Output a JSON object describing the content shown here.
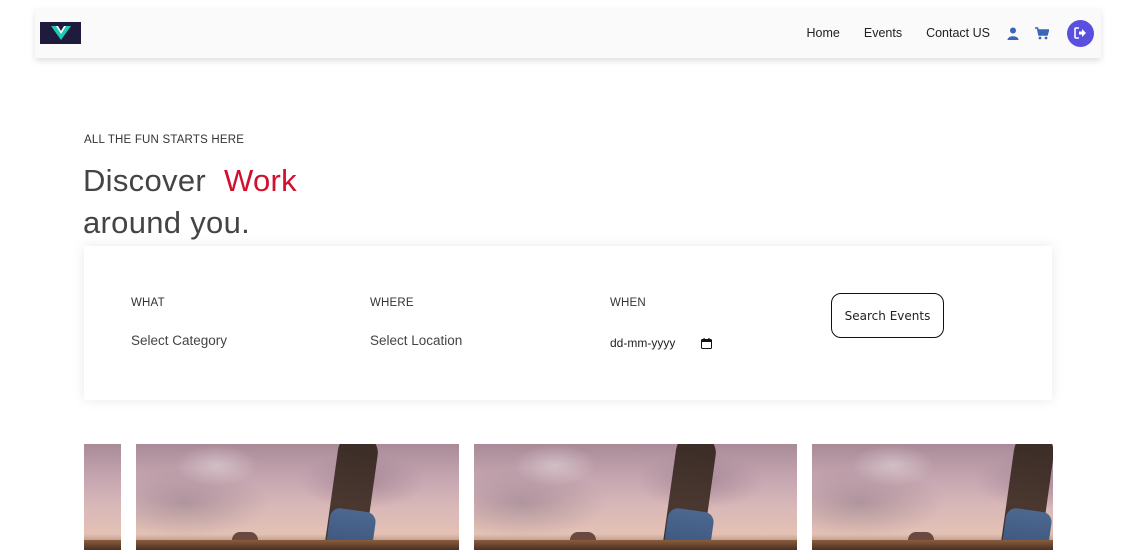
{
  "nav": {
    "links": [
      "Home",
      "Events",
      "Contact US"
    ],
    "icons": [
      "user-icon",
      "cart-icon",
      "logout-icon"
    ],
    "accent_color": "#5b4fe0"
  },
  "hero": {
    "eyebrow": "ALL THE FUN STARTS HERE",
    "headline_part1": "Discover",
    "headline_accent": "Work",
    "headline_part2": "around you.",
    "accent_color": "#d0102e"
  },
  "search": {
    "what_label": "WHAT",
    "what_value": "Select Category",
    "where_label": "WHERE",
    "where_value": "Select Location",
    "when_label": "WHEN",
    "when_placeholder": "dd-mm-yyyy",
    "button_label": "Search Events"
  },
  "events": {
    "count_visible": 4
  }
}
